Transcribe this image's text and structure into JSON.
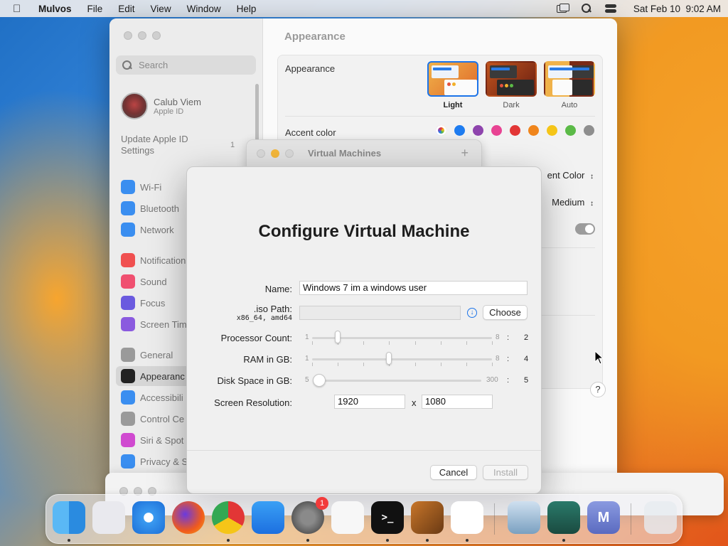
{
  "menubar": {
    "app_name": "Mulvos",
    "items": [
      "File",
      "Edit",
      "View",
      "Window",
      "Help"
    ],
    "datetime": "Sat Feb 10  9:02 AM"
  },
  "settings": {
    "search_placeholder": "Search",
    "user_name": "Calub Viem",
    "user_sub": "Apple ID",
    "update_text": "Update Apple ID Settings",
    "update_badge": "1",
    "sidebar_items": [
      {
        "label": "Wi-Fi",
        "color": "#3a8ef0",
        "icon": "wifi-icon"
      },
      {
        "label": "Bluetooth",
        "color": "#3a8ef0",
        "icon": "bluetooth-icon"
      },
      {
        "label": "Network",
        "color": "#3a8ef0",
        "icon": "globe-icon"
      },
      {
        "label": "Notification",
        "color": "#f05050",
        "icon": "bell-icon"
      },
      {
        "label": "Sound",
        "color": "#f05070",
        "icon": "speaker-icon"
      },
      {
        "label": "Focus",
        "color": "#6a5adf",
        "icon": "moon-icon"
      },
      {
        "label": "Screen Tim",
        "color": "#8a5adf",
        "icon": "hourglass-icon"
      },
      {
        "label": "General",
        "color": "#9a9a9a",
        "icon": "gear-icon"
      },
      {
        "label": "Appearanc",
        "color": "#222222",
        "icon": "appearance-icon"
      },
      {
        "label": "Accessibili",
        "color": "#3a8ef0",
        "icon": "accessibility-icon"
      },
      {
        "label": "Control Ce",
        "color": "#9a9a9a",
        "icon": "control-center-icon"
      },
      {
        "label": "Siri & Spot",
        "color": "#d04ad0",
        "icon": "siri-icon"
      },
      {
        "label": "Privacy & S",
        "color": "#3a8ef0",
        "icon": "hand-icon"
      }
    ],
    "page_title": "Appearance",
    "appearance_label": "Appearance",
    "themes": [
      "Light",
      "Dark",
      "Auto"
    ],
    "accent_label": "Accent color",
    "accent_colors": [
      "multicolor",
      "#1e7cf0",
      "#8e44ad",
      "#e84393",
      "#e23636",
      "#f0851c",
      "#f5c518",
      "#5bba47",
      "#8e8e8e"
    ],
    "highlight_value": "ent Color",
    "sidebar_size_value": "Medium",
    "help": "?"
  },
  "vm_window": {
    "title": "Virtual Machines",
    "add": "+"
  },
  "dialog": {
    "title": "Configure Virtual Machine",
    "name_label": "Name:",
    "name_value": "Windows 7 im a windows user",
    "iso_label": ".iso Path:",
    "iso_sub": "x86_64, amd64",
    "iso_value": "",
    "choose": "Choose",
    "download_icon": "↓",
    "processor": {
      "label": "Processor Count:",
      "min": "1",
      "max": "8",
      "value": "2",
      "colon": ":"
    },
    "ram": {
      "label": "RAM in GB:",
      "min": "1",
      "max": "8",
      "value": "4",
      "colon": ":"
    },
    "disk": {
      "label": "Disk Space in GB:",
      "min": "5",
      "max": "300",
      "value": "5",
      "colon": ":"
    },
    "resolution": {
      "label": "Screen Resolution:",
      "width": "1920",
      "height": "1080",
      "sep": "x"
    },
    "cancel": "Cancel",
    "install": "Install"
  },
  "dock": {
    "apps": [
      {
        "name": "Finder",
        "icon": "finder-icon"
      },
      {
        "name": "Launchpad",
        "icon": "launchpad-icon"
      },
      {
        "name": "Safari",
        "icon": "safari-icon"
      },
      {
        "name": "Firefox",
        "icon": "firefox-icon"
      },
      {
        "name": "Chrome",
        "icon": "chrome-icon"
      },
      {
        "name": "App Store",
        "icon": "app-store-icon"
      },
      {
        "name": "System Settings",
        "icon": "settings-icon",
        "badge": "1"
      },
      {
        "name": "TextEdit",
        "icon": "textedit-icon"
      },
      {
        "name": "Terminal",
        "icon": "terminal-icon",
        "glyph": ">_"
      },
      {
        "name": "GarageBand",
        "icon": "guitar-icon"
      },
      {
        "name": "VS Code",
        "icon": "vscode-icon"
      },
      {
        "name": "Preview",
        "icon": "preview-icon"
      },
      {
        "name": "Archive",
        "icon": "archive-icon"
      },
      {
        "name": "Mulvos",
        "icon": "mulvos-icon",
        "glyph": "M"
      },
      {
        "name": "Trash",
        "icon": "trash-icon"
      }
    ]
  }
}
